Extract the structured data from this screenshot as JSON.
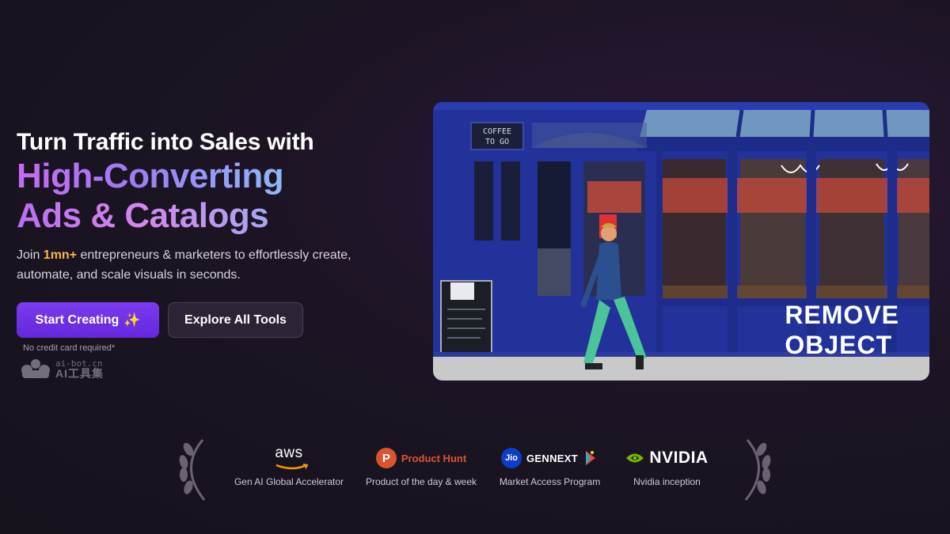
{
  "hero": {
    "headline_line1": "Turn Traffic into Sales with",
    "headline_line2": "High-Converting",
    "headline_line3": "Ads & Catalogs",
    "subtitle_prefix": "Join ",
    "subtitle_highlight": "1mn+",
    "subtitle_suffix": " entrepreneurs & marketers to effortlessly create, automate, and scale visuals in seconds.",
    "primary_button": "Start Creating",
    "primary_button_icon": "sparkle-icon",
    "secondary_button": "Explore All Tools",
    "note": "No credit card required*"
  },
  "watermark": {
    "domain": "ai-bot.cn",
    "name": "AI工具集"
  },
  "hero_image": {
    "storefront_sign_line1": "COFFEE",
    "storefront_sign_line2": "TO GO",
    "overlay_line1": "REMOVE",
    "overlay_line2": "OBJECT"
  },
  "awards": [
    {
      "logo_text": "aws",
      "icon": "aws-logo-icon",
      "caption": "Gen AI Global Accelerator"
    },
    {
      "logo_text": "Product Hunt",
      "icon_letter": "P",
      "icon": "product-hunt-icon",
      "caption": "Product of the day & week"
    },
    {
      "logo_text": "GENNEXT",
      "icon_letter": "Jio",
      "icon": "jio-icon",
      "caption": "Market Access Program"
    },
    {
      "logo_text": "NVIDIA",
      "icon": "nvidia-eye-icon",
      "caption": "Nvidia inception"
    }
  ],
  "colors": {
    "background": "#1c1424",
    "primary_button": "#6d2fe6",
    "highlight": "#f4b942",
    "storefront_blue": "#1f2f8f",
    "product_hunt": "#da552f"
  }
}
